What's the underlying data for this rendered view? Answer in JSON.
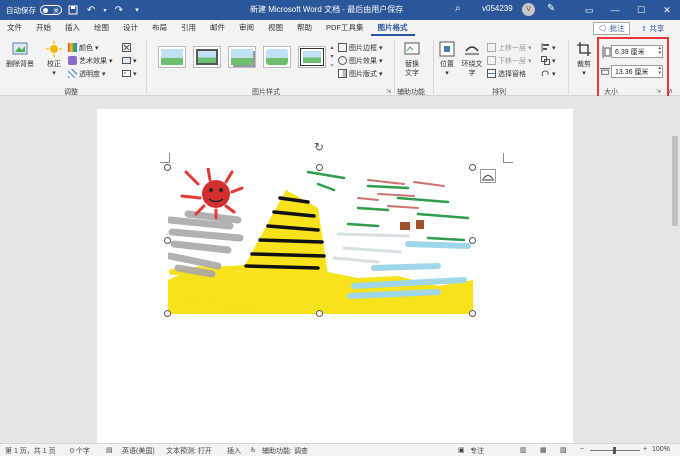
{
  "titlebar": {
    "autosave_label": "自动保存",
    "autosave_state": "关",
    "doc_title": "新建 Microsoft Word 文档 - 最后由用户保存",
    "user_name": "v054239",
    "avatar_letter": "V"
  },
  "menu": {
    "tabs": [
      "文件",
      "开始",
      "插入",
      "绘图",
      "设计",
      "布局",
      "引用",
      "邮件",
      "审阅",
      "视图",
      "帮助",
      "PDF工具集",
      "图片格式"
    ],
    "active": "图片格式",
    "comment_label": "批注",
    "share_label": "共享"
  },
  "ribbon": {
    "remove_bg": "删除背景",
    "correct": "校正",
    "color": "颜色",
    "artistic": "艺术效果",
    "transparency": "透明度",
    "adjust_group": "调整",
    "picture_styles_group": "图片样式",
    "border": "图片边框",
    "effects": "图片效果",
    "layout": "图片版式",
    "alt_text": "替换\n文字",
    "accessibility_group": "辅助功能",
    "position": "位置",
    "wrap_text": "环绕文\n字",
    "bring_forward": "上移一层",
    "send_backward": "下移一层",
    "selection_pane": "选择窗格",
    "arrange_group": "排列",
    "crop": "裁剪",
    "height": "6.39 厘米",
    "width": "13.36 厘米",
    "size_group": "大小"
  },
  "statusbar": {
    "page": "第 1 页，共 1 页",
    "words": "0 个字",
    "language": "英语(美国)",
    "text_predict": "文本预测: 打开",
    "insert_mode": "插入",
    "accessibility": "辅助功能: 调查",
    "focus": "专注",
    "zoom": "100%"
  },
  "colors": {
    "accent": "#2b579a",
    "highlight": "#e53935"
  }
}
